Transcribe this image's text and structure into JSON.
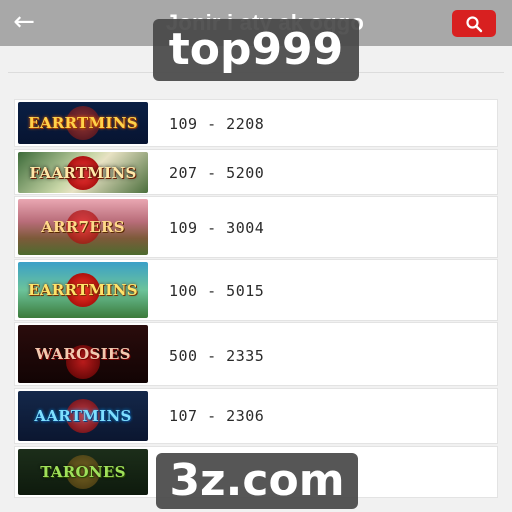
{
  "header": {
    "title": "Jonir i          aty ak   oggo",
    "back_icon": "arrow-left-icon",
    "search_icon": "search-icon",
    "search_color": "#d82020"
  },
  "games": [
    {
      "name": "EARRTMINS",
      "range": "109 - 2208"
    },
    {
      "name": "FAARTMINS",
      "range": "207 - 5200"
    },
    {
      "name": "ARR7ERS",
      "range": "109 - 3004"
    },
    {
      "name": "EARRTMINS",
      "range": "100 - 5015"
    },
    {
      "name": "WAROSIES",
      "range": "500 - 2335"
    },
    {
      "name": "AARTMINS",
      "range": "107 - 2306"
    },
    {
      "name": "TARONES",
      "range": ""
    }
  ],
  "watermarks": {
    "top": "top999",
    "bottom": "3z.com"
  }
}
